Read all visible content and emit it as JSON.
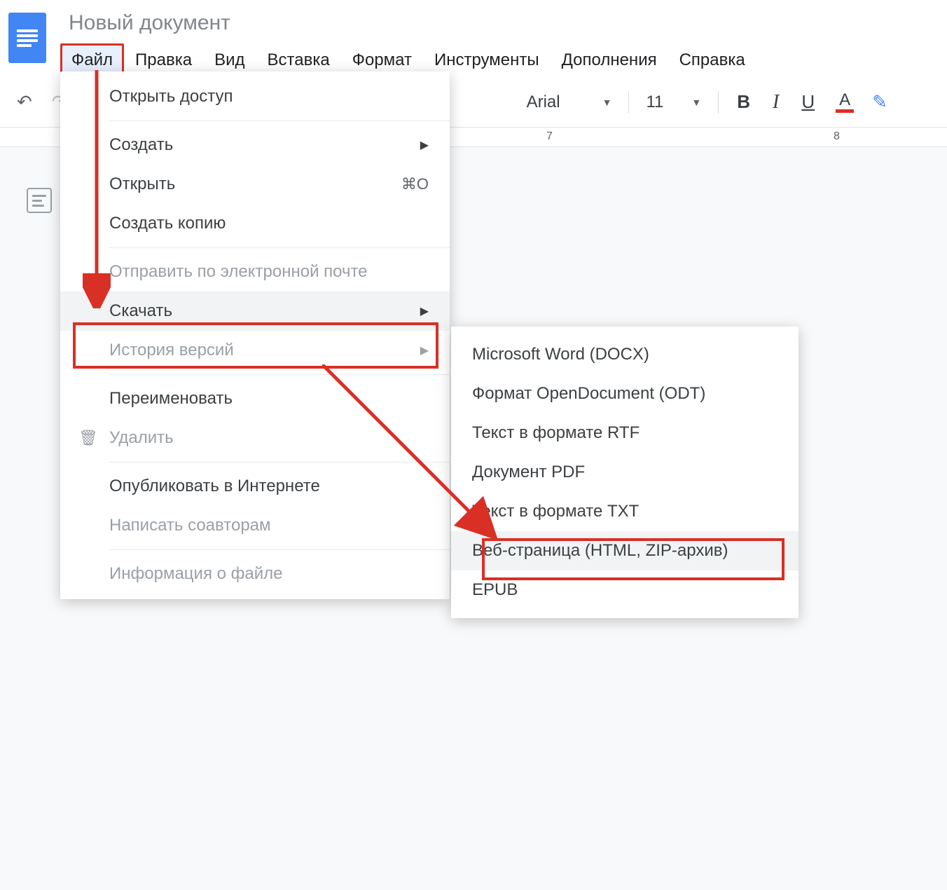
{
  "doc_title": "Новый документ",
  "menubar": {
    "file": "Файл",
    "edit": "Правка",
    "view": "Вид",
    "insert": "Вставка",
    "format": "Формат",
    "tools": "Инструменты",
    "addons": "Дополнения",
    "help": "Справка"
  },
  "toolbar": {
    "font_name": "Arial",
    "font_size": "11",
    "bold": "B",
    "italic": "I",
    "underline": "U",
    "text_color_letter": "A"
  },
  "ruler_ticks": [
    "7",
    "8"
  ],
  "file_menu": {
    "share": "Открыть доступ",
    "create": "Создать",
    "open": "Открыть",
    "open_shortcut": "⌘O",
    "copy": "Создать копию",
    "email": "Отправить по электронной почте",
    "download": "Скачать",
    "history": "История версий",
    "rename": "Переименовать",
    "delete": "Удалить",
    "publish": "Опубликовать в Интернете",
    "write_coauthors": "Написать соавторам",
    "file_info": "Информация о файле"
  },
  "download_submenu": {
    "docx": "Microsoft Word (DOCX)",
    "odt": "Формат OpenDocument (ODT)",
    "rtf": "Текст в формате RTF",
    "pdf": "Документ PDF",
    "txt": "Текст в формате TXT",
    "html": "Веб-страница (HTML, ZIP-архив)",
    "epub": "EPUB"
  }
}
